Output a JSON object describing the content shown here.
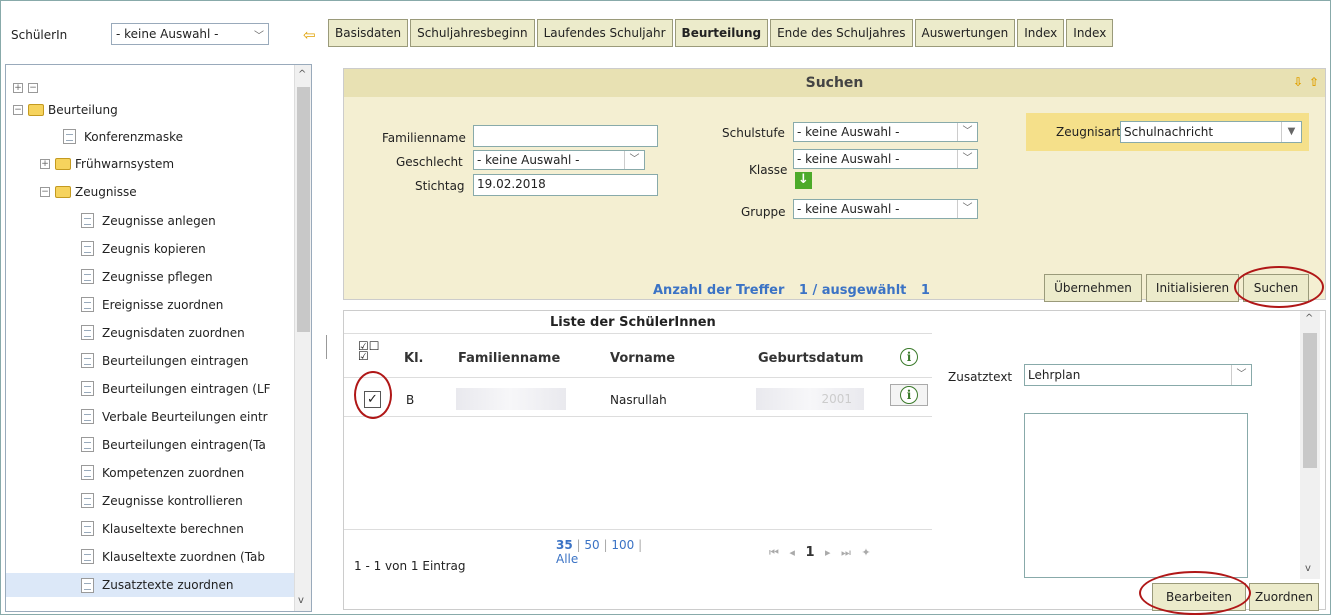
{
  "top": {
    "student_label": "SchülerIn",
    "student_select": "- keine Auswahl -",
    "tabs": [
      "Basisdaten",
      "Schuljahresbeginn",
      "Laufendes Schuljahr",
      "Beurteilung",
      "Ende des Schuljahres",
      "Auswertungen",
      "Index",
      "Index"
    ],
    "active_tab": "Beurteilung"
  },
  "tree": {
    "root": "Beurteilung",
    "items": [
      {
        "label": "Konferenzmaske",
        "type": "doc",
        "level": 1
      },
      {
        "label": "Frühwarnsystem",
        "type": "folder",
        "level": 1
      },
      {
        "label": "Zeugnisse",
        "type": "folder-open",
        "level": 1
      },
      {
        "label": "Zeugnisse anlegen",
        "type": "doc",
        "level": 2
      },
      {
        "label": "Zeugnis kopieren",
        "type": "doc",
        "level": 2
      },
      {
        "label": "Zeugnisse pflegen",
        "type": "doc",
        "level": 2
      },
      {
        "label": "Ereignisse zuordnen",
        "type": "doc",
        "level": 2
      },
      {
        "label": "Zeugnisdaten zuordnen",
        "type": "doc",
        "level": 2
      },
      {
        "label": "Beurteilungen eintragen",
        "type": "doc",
        "level": 2
      },
      {
        "label": "Beurteilungen eintragen (LF",
        "type": "doc",
        "level": 2
      },
      {
        "label": "Verbale Beurteilungen eintr",
        "type": "doc",
        "level": 2
      },
      {
        "label": "Beurteilungen eintragen(Ta",
        "type": "doc",
        "level": 2
      },
      {
        "label": "Kompetenzen zuordnen",
        "type": "doc",
        "level": 2
      },
      {
        "label": "Zeugnisse kontrollieren",
        "type": "doc",
        "level": 2
      },
      {
        "label": "Klauseltexte berechnen",
        "type": "doc",
        "level": 2
      },
      {
        "label": "Klauseltexte zuordnen (Tab",
        "type": "doc",
        "level": 2
      },
      {
        "label": "Zusatztexte zuordnen",
        "type": "doc",
        "level": 2,
        "selected": true
      }
    ]
  },
  "search": {
    "title": "Suchen",
    "familienname_label": "Familienname",
    "familienname_value": "",
    "geschlecht_label": "Geschlecht",
    "geschlecht_value": "- keine Auswahl -",
    "stichtag_label": "Stichtag",
    "stichtag_value": "19.02.2018",
    "schulstufe_label": "Schulstufe",
    "schulstufe_value": "- keine Auswahl -",
    "klasse_label": "Klasse",
    "klasse_value": "- keine Auswahl -",
    "gruppe_label": "Gruppe",
    "gruppe_value": "- keine Auswahl -",
    "zeugnisart_label": "Zeugnisart",
    "zeugnisart_value": "Schulnachricht",
    "treffer_text": "Anzahl der Treffer",
    "treffer_value": "1 / ausgewählt",
    "treffer_selected": "1",
    "btn_uebernehmen": "Übernehmen",
    "btn_initialisieren": "Initialisieren",
    "btn_suchen": "Suchen"
  },
  "list": {
    "title": "Liste der SchülerInnen",
    "columns": [
      "Kl.",
      "Familienname",
      "Vorname",
      "Geburtsdatum"
    ],
    "rows": [
      {
        "kl": "B",
        "familienname": "",
        "vorname": "Nasrullah",
        "geburtsdatum": "2001"
      }
    ],
    "pager_summary": "1 - 1 von 1 Eintrag",
    "page_sizes": [
      "35",
      "50",
      "100",
      "Alle"
    ],
    "current_page": "1",
    "zusatztext_label": "Zusatztext",
    "zusatztext_value": "Lehrplan",
    "btn_bearbeiten": "Bearbeiten",
    "btn_zuordnen": "Zuordnen"
  }
}
